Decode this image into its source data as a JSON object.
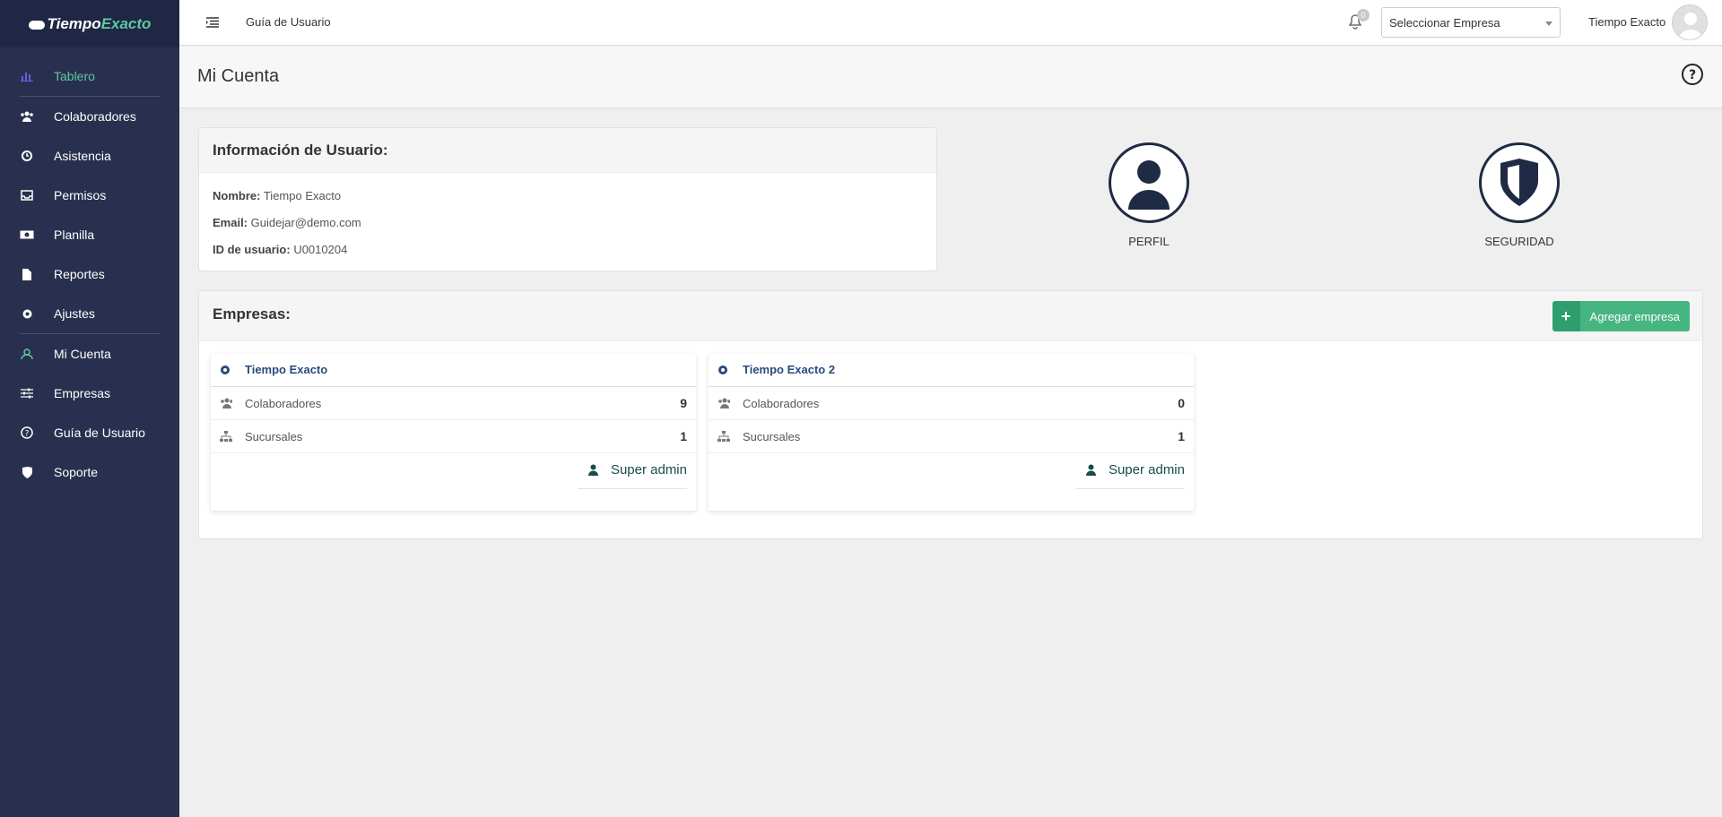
{
  "brand": {
    "part1": "Tiempo",
    "part2": "Exacto"
  },
  "sidebar": {
    "items": [
      {
        "label": "Tablero",
        "icon": "bar-chart-icon",
        "active": true
      },
      {
        "label": "Colaboradores",
        "icon": "users-icon"
      },
      {
        "label": "Asistencia",
        "icon": "clock-icon"
      },
      {
        "label": "Permisos",
        "icon": "inbox-icon"
      },
      {
        "label": "Planilla",
        "icon": "money-icon"
      },
      {
        "label": "Reportes",
        "icon": "file-icon"
      },
      {
        "label": "Ajustes",
        "icon": "gear-icon"
      },
      {
        "label": "Mi Cuenta",
        "icon": "user-outline-icon",
        "accent": true
      },
      {
        "label": "Empresas",
        "icon": "sliders-icon"
      },
      {
        "label": "Guía de Usuario",
        "icon": "question-circle-icon"
      },
      {
        "label": "Soporte",
        "icon": "shield-icon"
      }
    ]
  },
  "topbar": {
    "guide": "Guía de Usuario",
    "notifications_count": "0",
    "select_placeholder": "Seleccionar Empresa",
    "user_name": "Tiempo Exacto"
  },
  "page": {
    "title": "Mi Cuenta"
  },
  "user_info": {
    "heading": "Información de Usuario:",
    "name_label": "Nombre:",
    "name_value": "Tiempo Exacto",
    "email_label": "Email:",
    "email_value": "Guidejar@demo.com",
    "id_label": "ID de usuario:",
    "id_value": "U0010204"
  },
  "shortcuts": {
    "profile": "PERFIL",
    "security": "SEGURIDAD"
  },
  "companies": {
    "heading": "Empresas:",
    "add_label": "Agregar empresa",
    "items": [
      {
        "name": "Tiempo Exacto",
        "collab_label": "Colaboradores",
        "collab": "9",
        "branches_label": "Sucursales",
        "branches": "1",
        "role": "Super admin"
      },
      {
        "name": "Tiempo Exacto 2",
        "collab_label": "Colaboradores",
        "collab": "0",
        "branches_label": "Sucursales",
        "branches": "1",
        "role": "Super admin"
      }
    ]
  },
  "colors": {
    "sidebar": "#29304f",
    "accent": "#5cc8a0",
    "button": "#47b582",
    "company_link": "#2a4a7c"
  }
}
